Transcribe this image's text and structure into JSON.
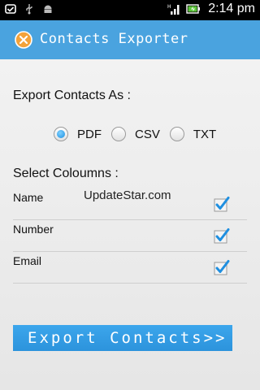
{
  "status_bar": {
    "time": "2:14 pm",
    "left_icons": [
      "mail-notification-icon",
      "usb-icon",
      "android-debug-icon"
    ],
    "right_icons": [
      "signal-icon",
      "battery-charging-icon"
    ]
  },
  "action_bar": {
    "title": "Contacts Exporter",
    "logo_icon": "app-logo-icon",
    "color": "#4aa3df"
  },
  "export_section": {
    "title": "Export Contacts As :",
    "options": [
      {
        "label": "PDF",
        "checked": true
      },
      {
        "label": "CSV",
        "checked": false
      },
      {
        "label": "TXT",
        "checked": false
      }
    ]
  },
  "columns_section": {
    "title": "Select Coloumns :",
    "items": [
      {
        "label": "Name",
        "checked": true
      },
      {
        "label": "Number",
        "checked": true
      },
      {
        "label": "Email",
        "checked": true
      }
    ]
  },
  "watermark": "UpdateStar.com",
  "export_button": {
    "label": "Export Contacts>>",
    "color": "#2c93dc"
  }
}
